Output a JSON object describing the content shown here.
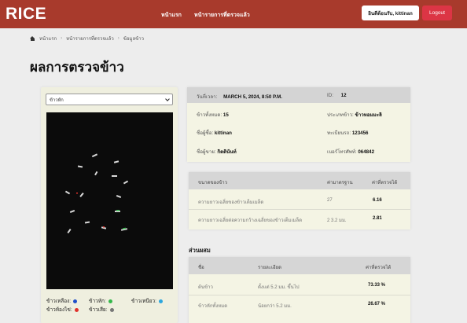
{
  "brand": {
    "logo": "RICE"
  },
  "nav": {
    "links": [
      "หน้าแรก",
      "หน้ารายการที่ตรวจแล้ว"
    ]
  },
  "user": {
    "welcome": "ยินดีต้อนรับ, kittinan",
    "logout": "Logout"
  },
  "breadcrumb": {
    "items": [
      "หน้าแรก",
      "หน้ารายการที่ตรวจแล้ว",
      "ข้อมูลข้าว"
    ]
  },
  "page": {
    "title": "ผลการตรวจข้าว"
  },
  "image_panel": {
    "select_value": "ข้าวหัก",
    "legend": [
      {
        "label": "ข้าวเหลือง:",
        "color": "#1f4fc9"
      },
      {
        "label": "ข้าวหัก:",
        "color": "#33b84a"
      },
      {
        "label": "ข้าวเหนียว:",
        "color": "#2ba6de"
      },
      {
        "label": "ข้าวท้องไข่:",
        "color": "#e0312b"
      },
      {
        "label": "ข้าวเสีย:",
        "color": "#777777"
      }
    ]
  },
  "info": {
    "created_label": "วันที่เวลา:",
    "created_value": "MARCH 5, 2024, 8:50 P.M.",
    "id_label": "ID:",
    "id_value": "12",
    "total_label": "ข้าวทั้งหมด:",
    "total_value": "15",
    "type_label": "ประเภทข้าว:",
    "type_value": "ข้าวหอมมะลิ",
    "buyer_label": "ชื่อผู้ซื้อ:",
    "buyer_value": "kittinan",
    "reg_label": "ทะเบียนรถ:",
    "reg_value": "123456",
    "seller_label": "ชื่อผู้ขาย:",
    "seller_value": "กิตตินันท์",
    "phone_label": "เบอร์โทรศัพท์:",
    "phone_value": "064842"
  },
  "size_table": {
    "headers": [
      "ขนาดของข้าว",
      "ค่ามาตรฐาน",
      "ค่าที่ตรวจได้"
    ],
    "rows": [
      [
        "ความยาวเฉลี่ยของข้าวเต็มเมล็ด",
        "27",
        "6.16"
      ],
      [
        "ความยาวเฉลี่ยต่อความกว้างเฉลี่ยของข้าวเต็มเมล็ด",
        "2 3.2 มม.",
        "2.81"
      ]
    ]
  },
  "mix": {
    "title": "ส่วนผสม",
    "headers": [
      "ชื่อ",
      "รายละเอียด",
      "ค่าที่ตรวจได้"
    ],
    "rows": [
      [
        "ต้นข้าว",
        "ตั้งแต่ 5.2 มม. ขึ้นไป",
        "73.33 %"
      ],
      [
        "ข้าวหักทั้งหมด",
        "น้อยกว่า 5.2 มม.",
        "26.67 %"
      ]
    ]
  }
}
